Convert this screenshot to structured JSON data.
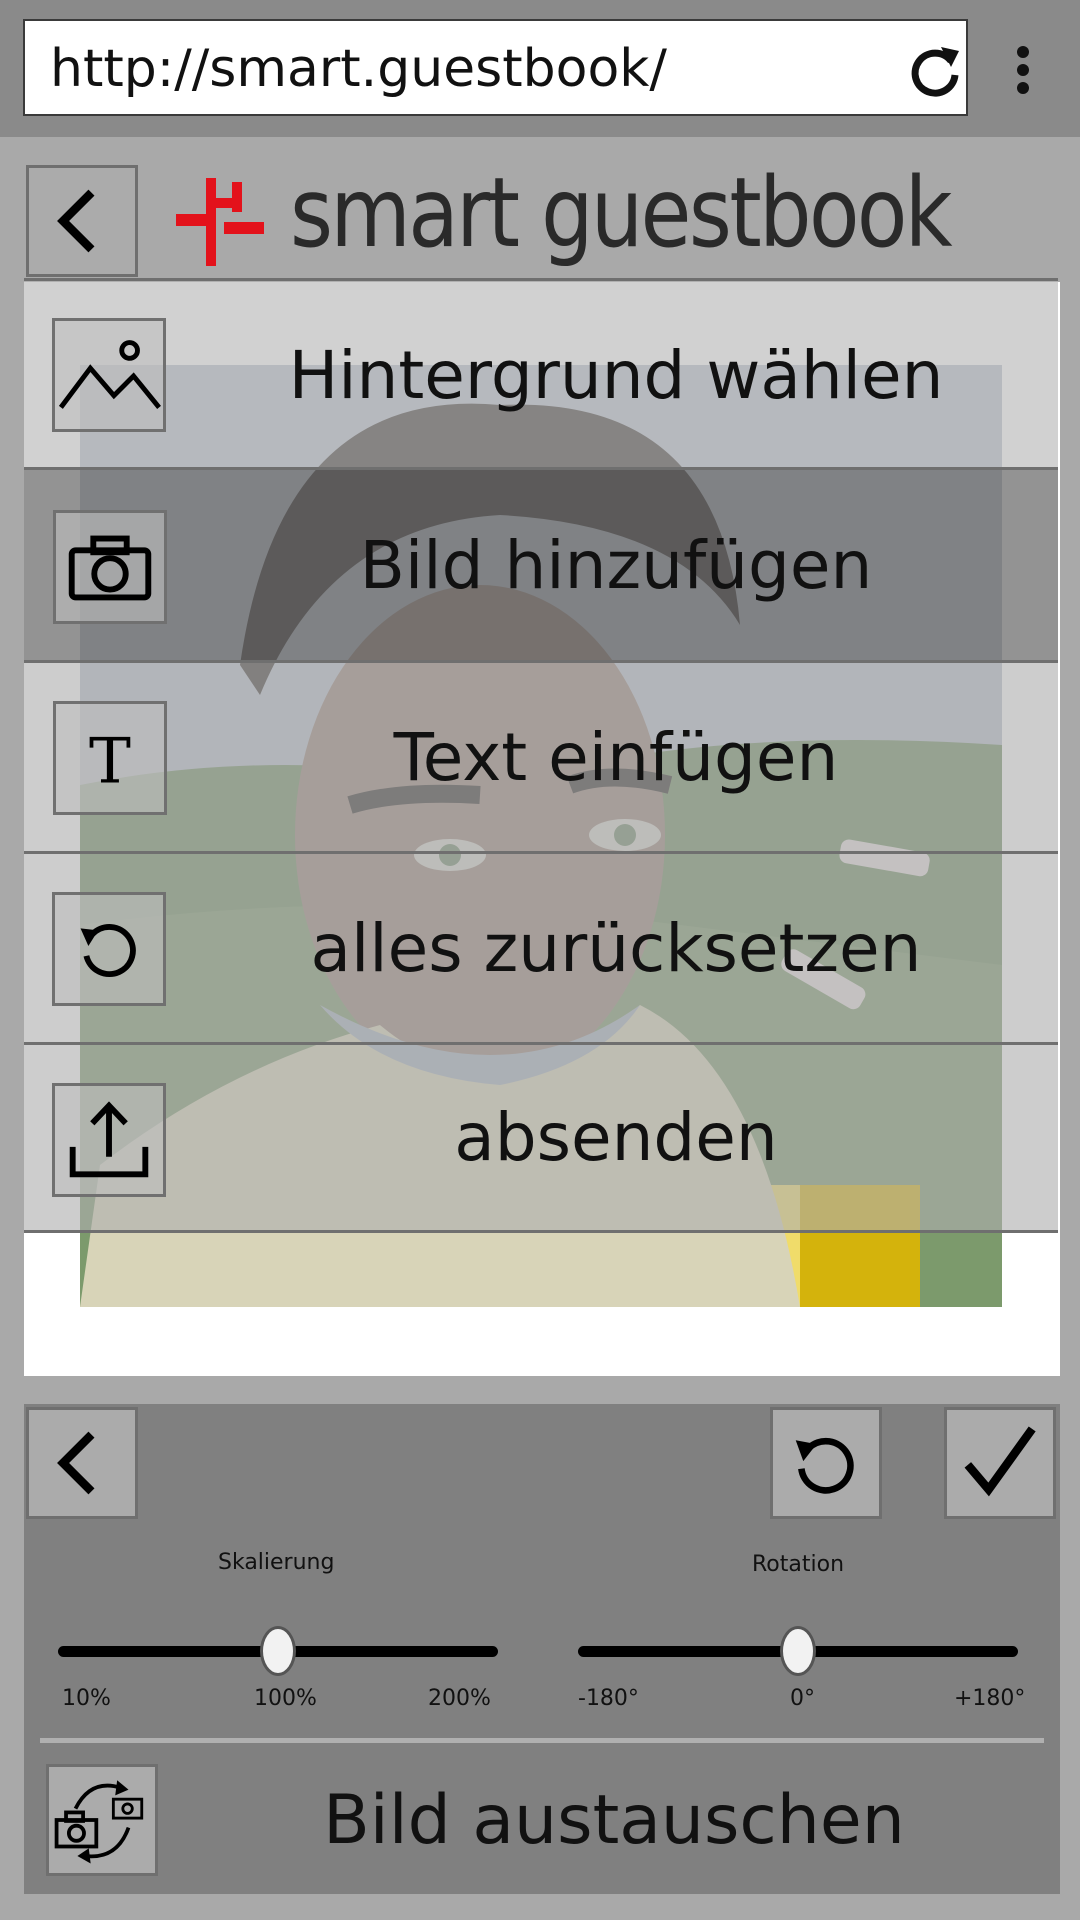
{
  "browser": {
    "url": "http://smart.guestbook/"
  },
  "header": {
    "brand": "smart guestbook"
  },
  "menu": {
    "items": [
      {
        "label": "Hintergrund wählen",
        "icon": "landscape-icon"
      },
      {
        "label": "Bild hinzufügen",
        "icon": "camera-icon"
      },
      {
        "label": "Text einfügen",
        "icon": "text-icon"
      },
      {
        "label": "alles zurücksetzen",
        "icon": "reset-icon"
      },
      {
        "label": "absenden",
        "icon": "upload-icon"
      }
    ]
  },
  "editor": {
    "scale": {
      "title": "Skalierung",
      "min_label": "10%",
      "mid_label": "100%",
      "max_label": "200%",
      "value": "100%"
    },
    "rotation": {
      "title": "Rotation",
      "min_label": "-180°",
      "mid_label": "0°",
      "max_label": "+180°",
      "value": "0°"
    },
    "swap_label": "Bild austauschen"
  },
  "colors": {
    "brand_red": "#e3121b",
    "panel_gray": "#808080",
    "page_gray": "#a9a9a9"
  }
}
